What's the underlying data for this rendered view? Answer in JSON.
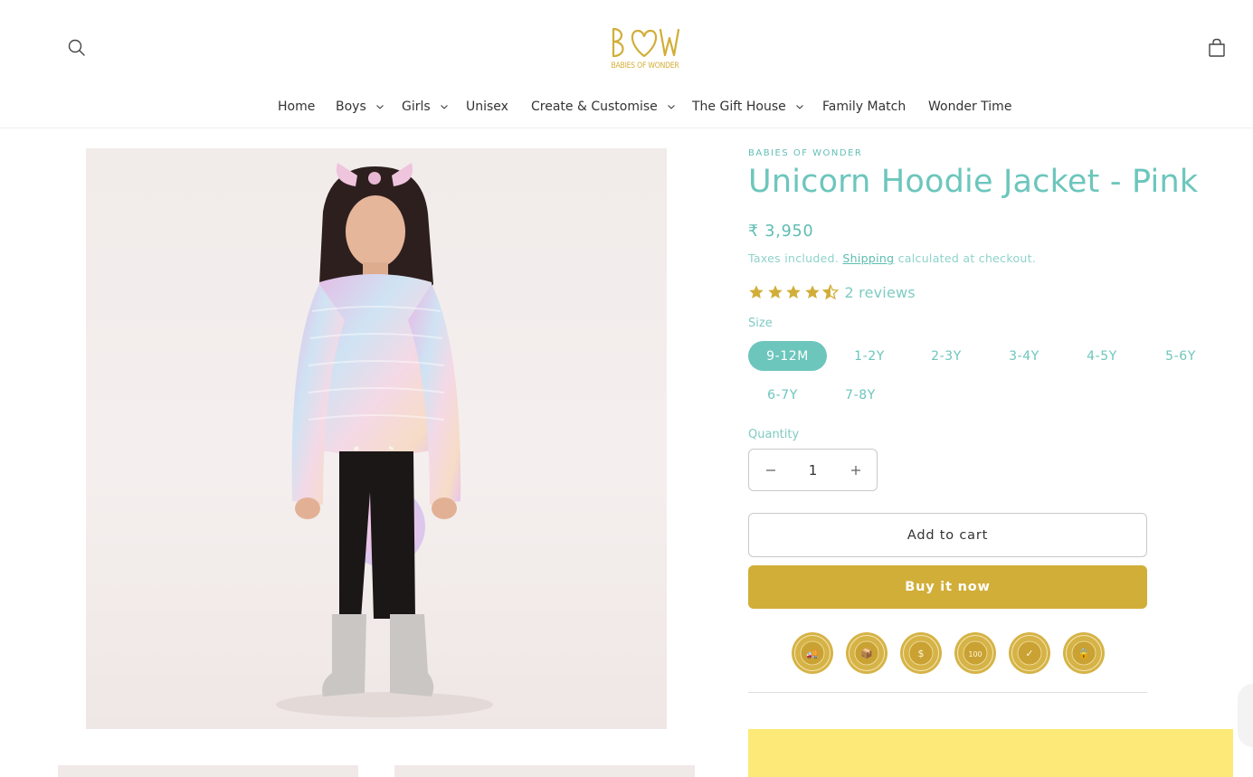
{
  "brand": {
    "logo_text": "BOW",
    "logo_subtitle": "BABIES OF WONDER"
  },
  "nav": {
    "items": [
      {
        "label": "Home",
        "has_dropdown": false
      },
      {
        "label": "Boys",
        "has_dropdown": true
      },
      {
        "label": "Girls",
        "has_dropdown": true
      },
      {
        "label": "Unisex",
        "has_dropdown": false
      },
      {
        "label": "Create & Customise",
        "has_dropdown": true
      },
      {
        "label": "The Gift House",
        "has_dropdown": true
      },
      {
        "label": "Family Match",
        "has_dropdown": false
      },
      {
        "label": "Wonder Time",
        "has_dropdown": false
      }
    ]
  },
  "product": {
    "vendor": "BABIES OF WONDER",
    "title": "Unicorn Hoodie Jacket - Pink",
    "price": "₹ 3,950",
    "tax_prefix": "Taxes included.",
    "tax_link": "Shipping",
    "tax_suffix": "calculated at checkout.",
    "rating": 4.5,
    "reviews_label": "2 reviews",
    "size_label": "Size",
    "sizes": [
      "9-12M",
      "1-2Y",
      "2-3Y",
      "3-4Y",
      "4-5Y",
      "5-6Y",
      "6-7Y",
      "7-8Y"
    ],
    "selected_size": "9-12M",
    "quantity_label": "Quantity",
    "quantity": "1",
    "add_to_cart_label": "Add to cart",
    "buy_now_label": "Buy it now"
  },
  "badges": [
    {
      "icon": "free-shipping-badge-icon",
      "text": "FREE SHIPPING"
    },
    {
      "icon": "free-returns-badge-icon",
      "text": "FREE RETURNS"
    },
    {
      "icon": "money-back-badge-icon",
      "text": "MONEY BACK GUARANTEE"
    },
    {
      "icon": "premium-quality-badge-icon",
      "text": "PREMIUM 100% QUALITY"
    },
    {
      "icon": "satisfaction-badge-icon",
      "text": "SATISFACTION GUARANTEE"
    },
    {
      "icon": "secure-checkout-badge-icon",
      "text": "SECURE CHECKOUT"
    }
  ],
  "colors": {
    "accent_teal": "#6cc6bc",
    "gold": "#d1ae38",
    "promo_yellow": "#fce978"
  }
}
